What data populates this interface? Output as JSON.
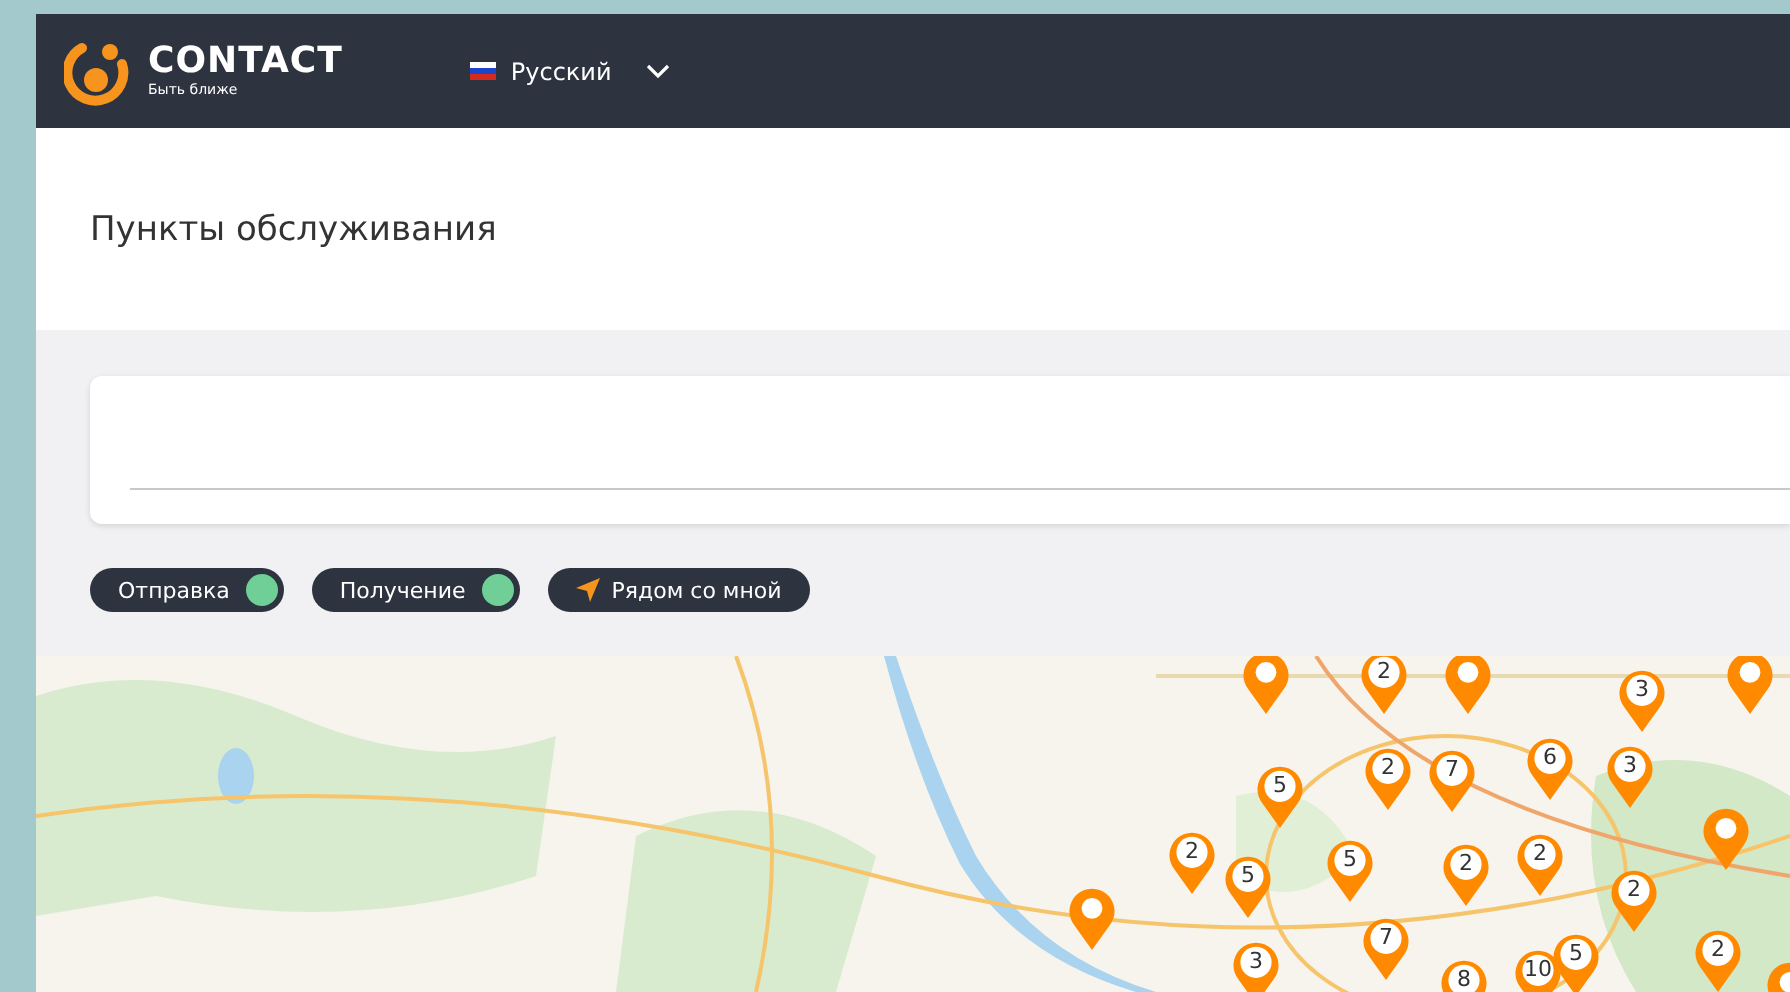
{
  "header": {
    "brand": "CONTACT",
    "tagline": "Быть ближе",
    "language": "Русский"
  },
  "page_title": "Пункты обслуживания",
  "filters": [
    {
      "label": "Отправка",
      "kind": "toggle",
      "on": true
    },
    {
      "label": "Получение",
      "kind": "toggle",
      "on": true
    },
    {
      "label": "Рядом со мной",
      "kind": "nearby"
    }
  ],
  "map": {
    "markers": [
      {
        "kind": "pin"
      },
      {
        "kind": "cluster",
        "count": "2"
      },
      {
        "kind": "pin"
      },
      {
        "kind": "cluster",
        "count": "3"
      },
      {
        "kind": "pin"
      },
      {
        "kind": "cluster",
        "count": "5"
      },
      {
        "kind": "cluster",
        "count": "2"
      },
      {
        "kind": "cluster",
        "count": "7"
      },
      {
        "kind": "cluster",
        "count": "6"
      },
      {
        "kind": "cluster",
        "count": "3"
      },
      {
        "kind": "cluster",
        "count": "2"
      },
      {
        "kind": "cluster",
        "count": "5"
      },
      {
        "kind": "cluster",
        "count": "5"
      },
      {
        "kind": "cluster",
        "count": "2"
      },
      {
        "kind": "cluster",
        "count": "2"
      },
      {
        "kind": "pin"
      },
      {
        "kind": "cluster",
        "count": "2"
      },
      {
        "kind": "pin"
      },
      {
        "kind": "cluster",
        "count": "7"
      },
      {
        "kind": "cluster",
        "count": "3"
      },
      {
        "kind": "cluster",
        "count": "10"
      },
      {
        "kind": "cluster",
        "count": "8"
      },
      {
        "kind": "cluster",
        "count": "5"
      },
      {
        "kind": "cluster",
        "count": "2"
      },
      {
        "kind": "pin"
      }
    ]
  }
}
